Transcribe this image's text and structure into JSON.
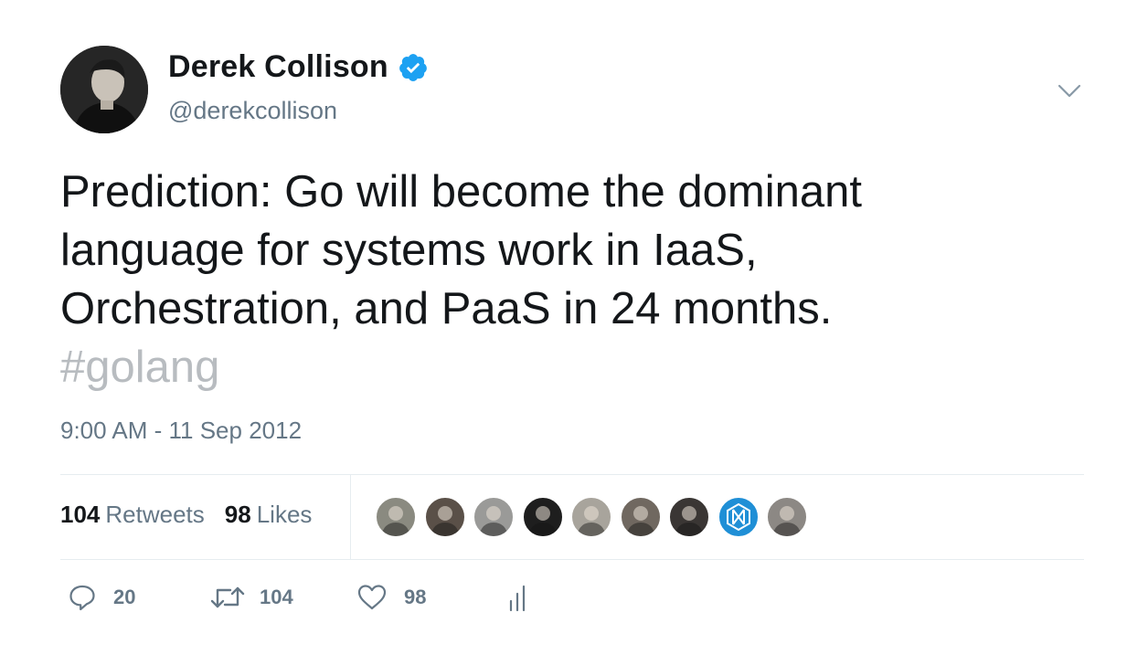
{
  "author": {
    "name": "Derek Collison",
    "handle": "@derekcollison",
    "verified_color": "#1da1f2"
  },
  "tweet": {
    "lines": [
      "Prediction: Go will become the dominant",
      "language for systems work in IaaS,",
      "Orchestration, and PaaS in 24 months."
    ],
    "hashtag": "#golang",
    "timestamp": "9:00 AM - 11 Sep 2012"
  },
  "stats": {
    "retweets_count": "104",
    "retweets_label": "Retweets",
    "likes_count": "98",
    "likes_label": "Likes"
  },
  "liker_avatars": [
    {
      "icon": "user-avatar",
      "color": "#8a8a80"
    },
    {
      "icon": "user-avatar",
      "color": "#5a5048"
    },
    {
      "icon": "user-avatar",
      "color": "#9a9a98"
    },
    {
      "icon": "user-avatar",
      "color": "#1e1e1e"
    },
    {
      "icon": "user-avatar",
      "color": "#a8a49c"
    },
    {
      "icon": "user-avatar",
      "color": "#706860"
    },
    {
      "icon": "user-avatar",
      "color": "#3a3634"
    },
    {
      "icon": "brand-logo-avatar",
      "color": "#1f8fd6"
    },
    {
      "icon": "user-avatar",
      "color": "#8c8884"
    }
  ],
  "actions": {
    "reply_count": "20",
    "retweet_count": "104",
    "like_count": "98"
  },
  "colors": {
    "text": "#14171a",
    "secondary": "#657786",
    "hashtag": "#b8bcc0",
    "divider": "#e6ecf0"
  }
}
